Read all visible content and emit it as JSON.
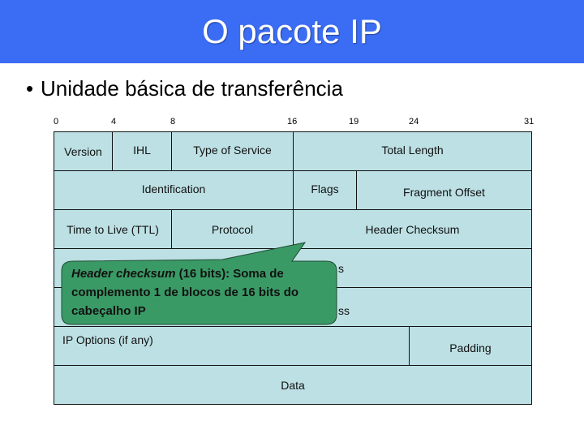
{
  "header": {
    "title": "O pacote IP",
    "background": "#3a6cf4"
  },
  "bullets": [
    "Unidade básica de transferência"
  ],
  "diagram": {
    "bit_labels": [
      "0",
      "4",
      "8",
      "16",
      "19",
      "24",
      "31"
    ],
    "rows": [
      [
        "Version",
        "IHL",
        "Type of Service",
        "Total Length"
      ],
      [
        "Identification",
        "Flags",
        "Fragment Offset"
      ],
      [
        "Time to Live (TTL)",
        "Protocol",
        "Header Checksum"
      ],
      [
        "Source Address"
      ],
      [
        "Destination Address"
      ],
      [
        "IP Options (if any)",
        "Padding"
      ],
      [
        "Data"
      ]
    ],
    "visible_fragments": {
      "source_address": "s",
      "destination_address": "ss"
    },
    "cell_color": "#bde0e4"
  },
  "callout": {
    "term": "Header checksum",
    "rest": " (16 bits): Soma de complemento 1 de blocos de 16 bits do cabeçalho IP",
    "color": "#3a9a66"
  }
}
